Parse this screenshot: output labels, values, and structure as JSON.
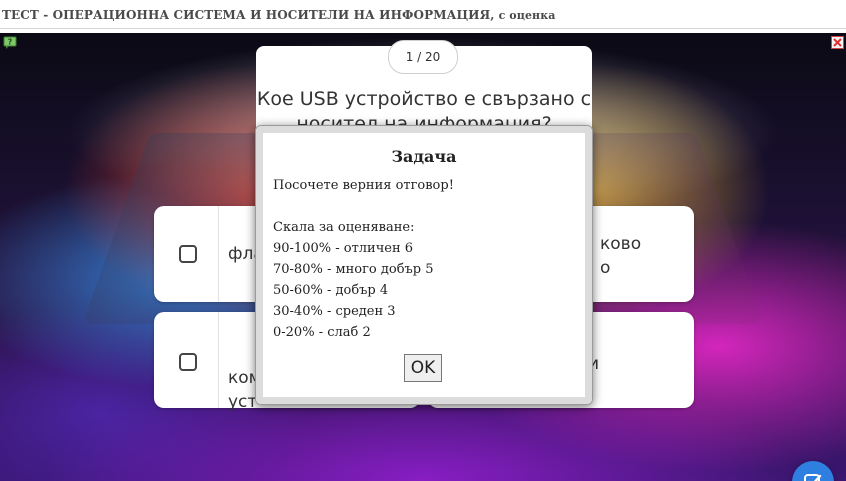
{
  "header": {
    "title": "ТЕСТ - ОПЕРАЦИОННА СИСТЕМА И НОСИТЕЛИ НА ИНФОРМАЦИЯ,",
    "subtitle": "с оценка"
  },
  "quiz": {
    "counter": "1 / 20",
    "question": "Кое USB устройство е свързано с носител на информация?",
    "answers": [
      {
        "text": "фла"
      },
      {
        "text": "..."
      },
      {
        "text": "ком\nуст"
      },
      {
        "text": ""
      }
    ],
    "right_top_fragment_1": "ково",
    "right_top_fragment_2": "о",
    "right_bottom_fragment": "и"
  },
  "dialog": {
    "title": "Задача",
    "lines": [
      "Посочете верния отговор!",
      "",
      "Скала за оценяване:",
      "90-100% - отличен 6",
      "70-80% - много добър 5",
      "50-60% - добър 4",
      "30-40% - среден 3",
      "0-20% - слаб 2"
    ],
    "ok_label": "OK"
  },
  "icons": {
    "help": "help-icon",
    "close": "close-icon",
    "check": "check-edit-icon"
  },
  "colors": {
    "accent": "#2f7fe0",
    "header_text": "#4a4a4a"
  }
}
